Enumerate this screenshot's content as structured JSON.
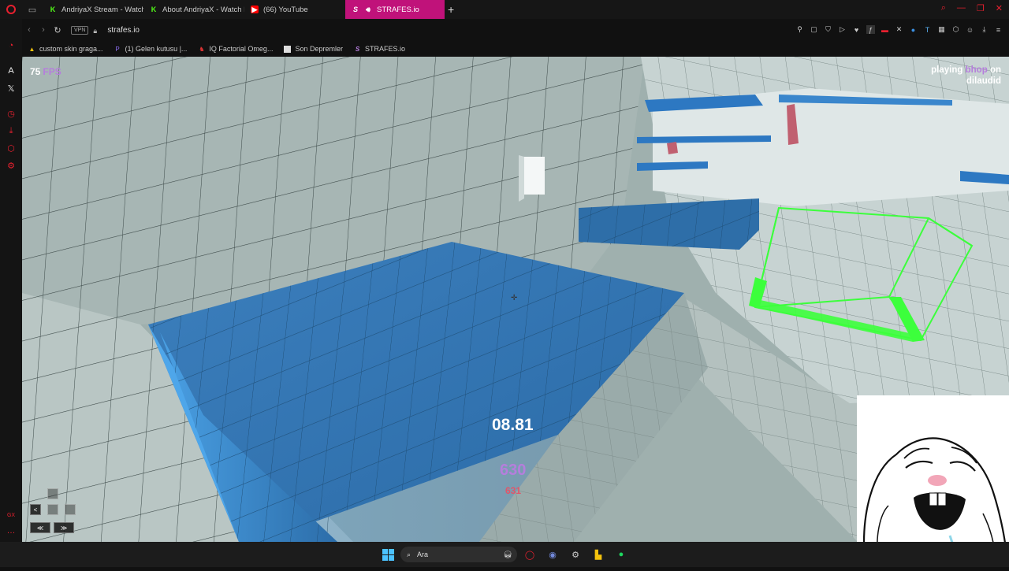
{
  "browser": {
    "tabs": [
      {
        "label": "AndriyaX Stream - Watch",
        "favicon": "kick-icon",
        "active": false
      },
      {
        "label": "About AndriyaX - Watch L",
        "favicon": "kick-icon",
        "active": false
      },
      {
        "label": "(66) YouTube",
        "favicon": "youtube-icon",
        "active": false
      },
      {
        "label": "STRAFES.io",
        "favicon": "strafes-icon",
        "active": true
      }
    ],
    "url": "strafes.io",
    "vpn_label": "VPN",
    "bookmarks": [
      {
        "label": "custom skin graga..."
      },
      {
        "label": "(1) Gelen kutusu |..."
      },
      {
        "label": "IQ Factorial Omeg..."
      },
      {
        "label": "Son Depremler"
      },
      {
        "label": "STRAFES.io"
      }
    ],
    "accent_color": "#c0127a"
  },
  "game": {
    "fps_value": "75",
    "fps_label": "FPS",
    "playing_prefix": "playing",
    "style": "bhop",
    "on_word": "on",
    "map": "dilaudid",
    "timer": "08.81",
    "speed": "630",
    "speed_secondary": "631",
    "key_labels": {
      "left": "<",
      "down": "≪",
      "jump": "≫"
    }
  },
  "taskbar": {
    "search_placeholder": "Ara"
  }
}
